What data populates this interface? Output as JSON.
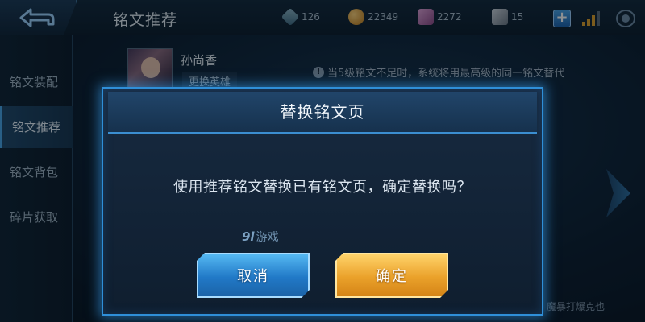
{
  "header": {
    "title": "铭文推荐",
    "resources": [
      {
        "name": "gem",
        "value": "126"
      },
      {
        "name": "gold",
        "value": "22349"
      },
      {
        "name": "fragment",
        "value": "2272"
      },
      {
        "name": "ticket",
        "value": "15"
      }
    ],
    "plus_label": "+"
  },
  "sidebar": {
    "items": [
      {
        "label": "铭文装配",
        "active": false
      },
      {
        "label": "铭文推荐",
        "active": true
      },
      {
        "label": "铭文背包",
        "active": false
      },
      {
        "label": "碎片获取",
        "active": false
      }
    ]
  },
  "hero": {
    "name": "孙尚香",
    "change_label": "更换英雄"
  },
  "tip": {
    "icon": "!",
    "text": "当5级铭文不足时，系统将用最高级的同一铭文替代"
  },
  "bottom_text": "魔暴打爆克也",
  "modal": {
    "title": "替换铭文页",
    "message": "使用推荐铭文替换已有铭文页，确定替换吗？",
    "watermark_num": "9l",
    "watermark_text": "游戏",
    "cancel_label": "取消",
    "confirm_label": "确定"
  },
  "colors": {
    "accent_blue": "#2f8fd8",
    "cancel_button": "#2179c7",
    "confirm_button": "#eaa12a"
  }
}
